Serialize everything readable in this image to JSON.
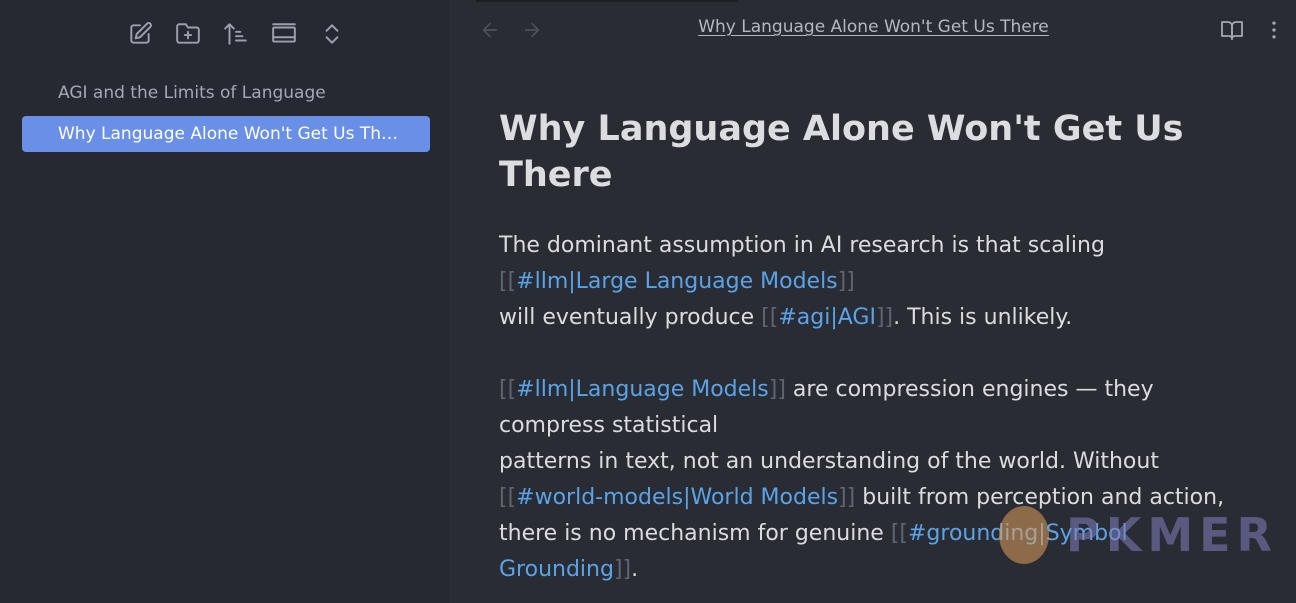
{
  "sidebar": {
    "toolbar": [
      {
        "name": "new-note-icon"
      },
      {
        "name": "new-folder-icon"
      },
      {
        "name": "sort-icon"
      },
      {
        "name": "collapse-view-icon"
      },
      {
        "name": "expand-collapse-icon"
      }
    ],
    "files": [
      {
        "label": "AGI and the Limits of Language",
        "active": false
      },
      {
        "label": "Why Language Alone Won't Get Us There",
        "active": true
      }
    ]
  },
  "header": {
    "back_icon": "arrow-left-icon",
    "forward_icon": "arrow-right-icon",
    "title": "Why Language Alone Won't Get Us There",
    "reading_view_icon": "book-open-icon",
    "more_icon": "more-vertical-icon"
  },
  "document": {
    "title": "Why Language Alone Won't Get Us There",
    "p1": {
      "t1": "The dominant assumption in AI research is that scaling",
      "l1": "#llm|Large Language Models",
      "t2": "will eventually produce ",
      "l2": "#agi|AGI",
      "t3": ". This is unlikely."
    },
    "p2": {
      "l1": "#llm|Language Models",
      "t1": " are compression engines — they compress statistical",
      "t2": "patterns in text, not an understanding of the world. Without",
      "l2": "#world-models|World Models",
      "t3": " built from perception and action, there is no mechanism for genuine ",
      "l3": "#grounding|Symbol Grounding",
      "t4": "."
    },
    "open_bracket": "[[",
    "close_bracket": "]]"
  },
  "watermark": {
    "text": "PKMER"
  },
  "colors": {
    "accent": "#6a8fe6",
    "link": "#5aa3e8",
    "bracket": "#5d6472"
  }
}
